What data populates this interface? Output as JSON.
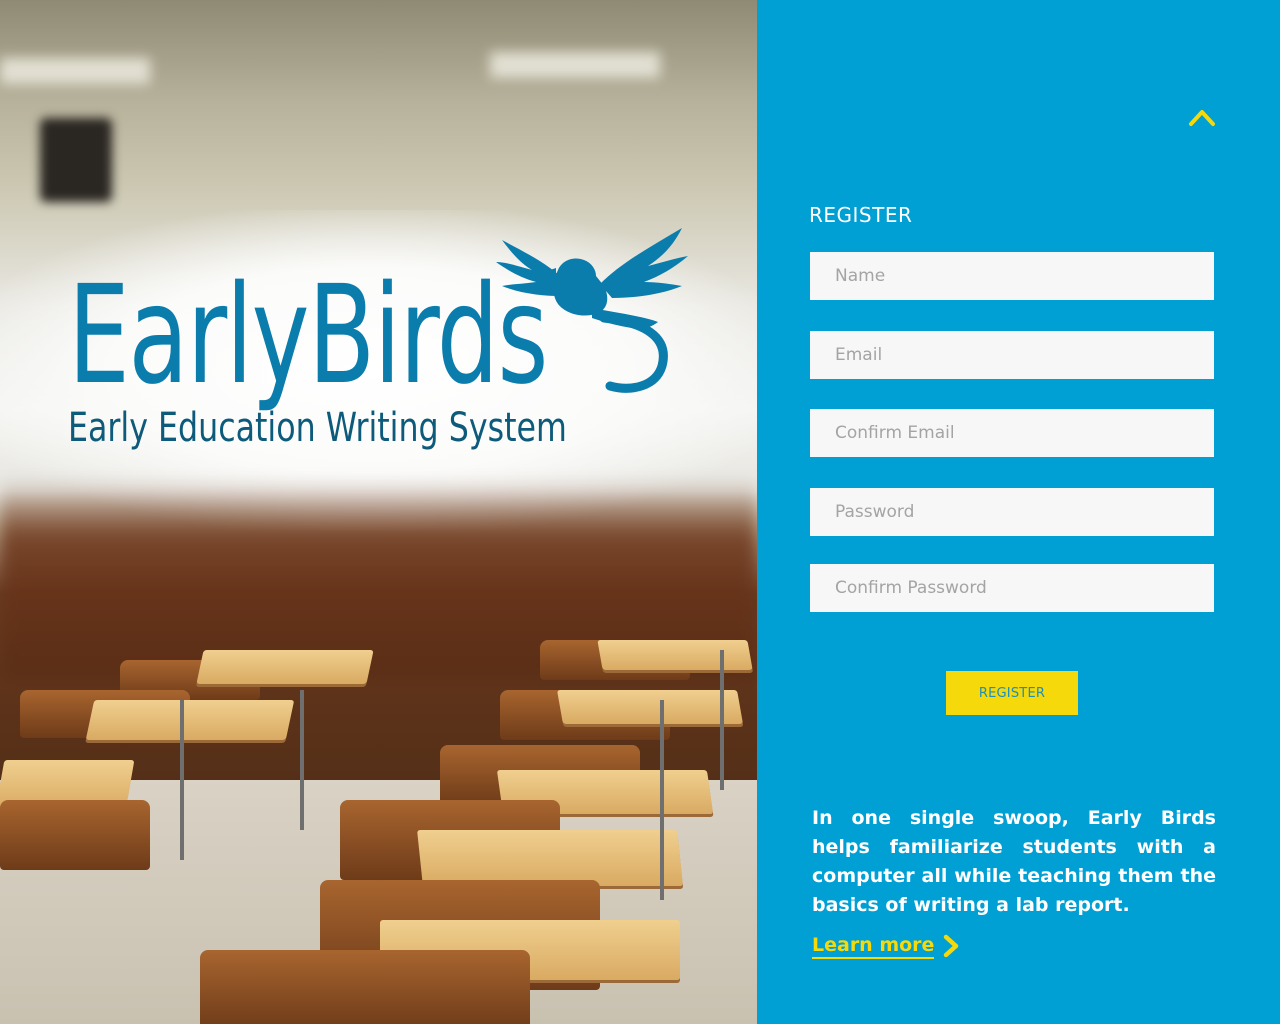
{
  "logo": {
    "title": "EarlyBirds",
    "subtitle": "Early Education Writing System",
    "icon": "bird-icon"
  },
  "panel": {
    "collapse_icon": "chevron-up-icon",
    "title": "REGISTER",
    "fields": {
      "name": {
        "placeholder": "Name",
        "value": ""
      },
      "email": {
        "placeholder": "Email",
        "value": ""
      },
      "confirm_email": {
        "placeholder": "Confirm Email",
        "value": ""
      },
      "password": {
        "placeholder": "Password",
        "value": ""
      },
      "confirm_password": {
        "placeholder": "Confirm Password",
        "value": ""
      }
    },
    "submit_label": "REGISTER",
    "blurb": "In one single swoop, Early Birds helps familiarize students with a computer all while teaching them the basics of writing a lab report.",
    "learn_more": "Learn more",
    "learn_more_icon": "chevron-right-icon"
  },
  "colors": {
    "panel_bg": "#009fd4",
    "accent_yellow": "#f5d90a",
    "logo_blue": "#0b7dad",
    "logo_dark_blue": "#0d5a7a",
    "field_bg": "#f7f7f7"
  }
}
